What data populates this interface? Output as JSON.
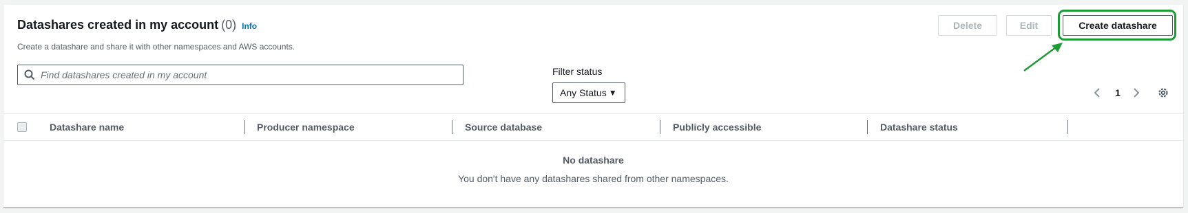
{
  "section": {
    "title": "Datashares created in my account",
    "count": "(0)",
    "info_link": "Info",
    "description": "Create a datashare and share it with other namespaces and AWS accounts."
  },
  "actions": {
    "delete_label": "Delete",
    "edit_label": "Edit",
    "create_label": "Create datashare"
  },
  "search": {
    "placeholder": "Find datashares created in my account",
    "value": ""
  },
  "filter": {
    "label": "Filter status",
    "selected": "Any Status"
  },
  "pagination": {
    "current_page": "1"
  },
  "table": {
    "columns": [
      "Datashare name",
      "Producer namespace",
      "Source database",
      "Publicly accessible",
      "Datashare status"
    ],
    "rows": [],
    "empty_title": "No datashare",
    "empty_message": "You don't have any datashares shared from other namespaces."
  },
  "colors": {
    "highlight": "#1d9b35",
    "link": "#0073bb",
    "primary_border": "#545b64",
    "disabled_text": "#aab7b8"
  },
  "icons": {
    "search": "search-icon",
    "caret": "caret-down-icon",
    "prev": "chevron-left-icon",
    "next": "chevron-right-icon",
    "settings": "gear-icon",
    "annotation": "arrow-icon"
  }
}
